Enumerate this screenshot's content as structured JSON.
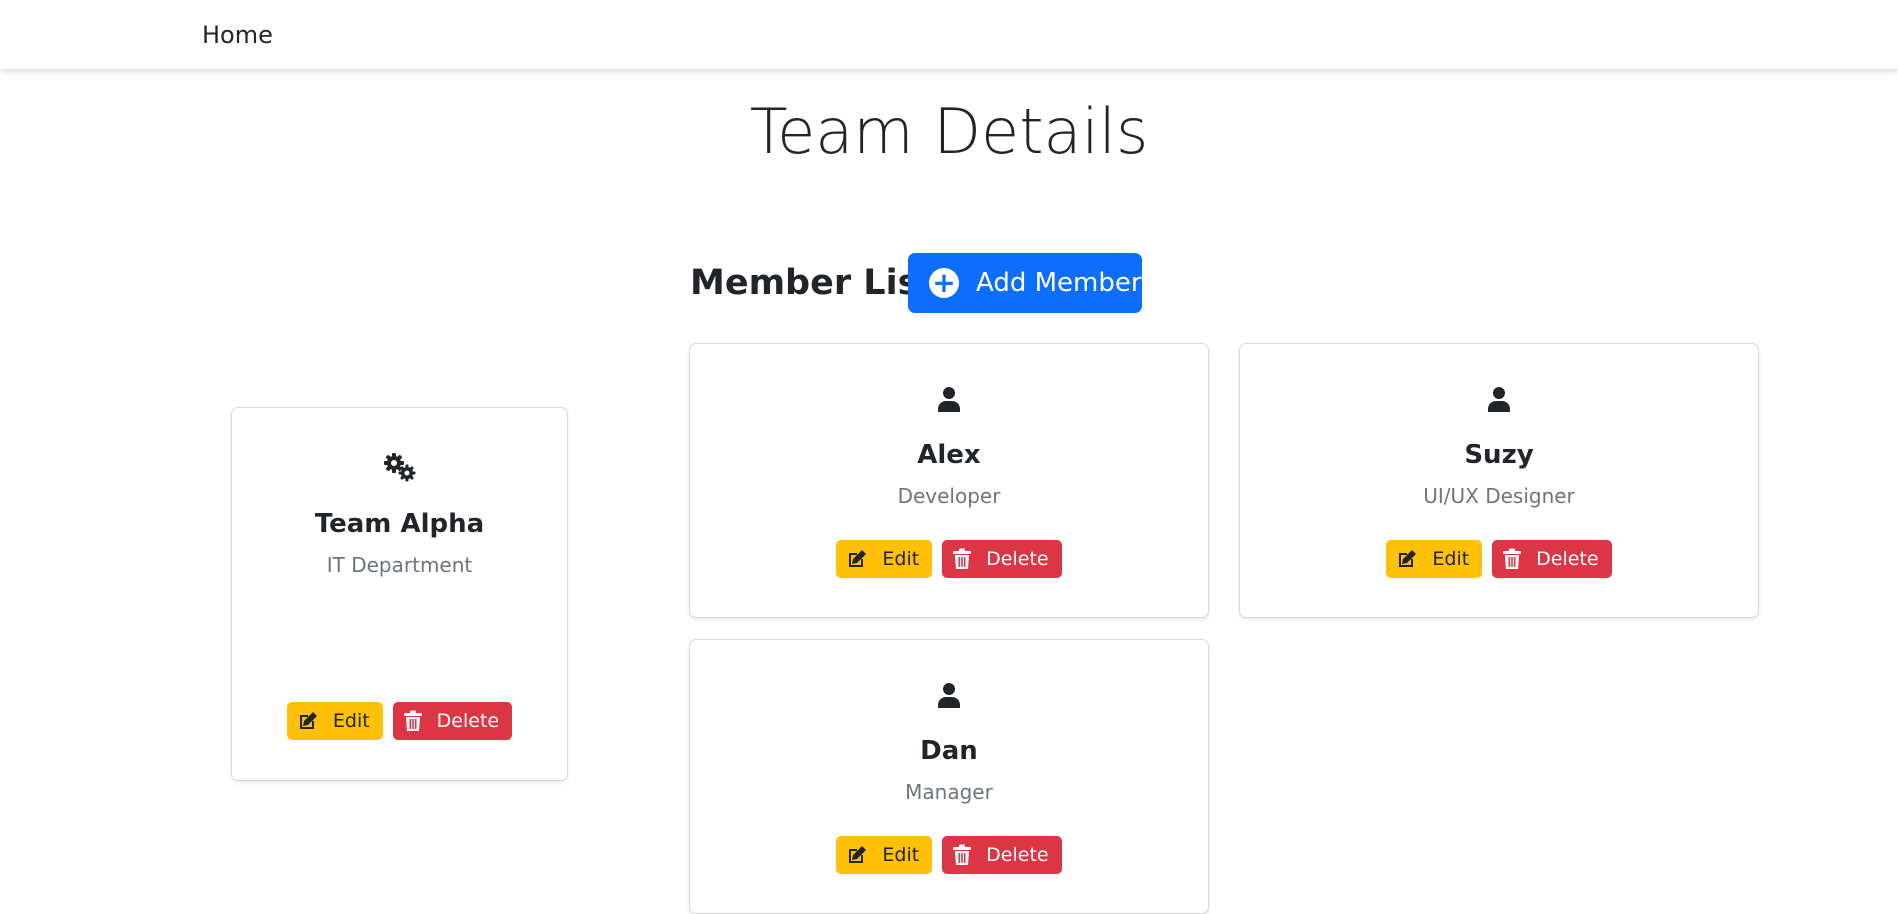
{
  "nav": {
    "home_label": "Home"
  },
  "page": {
    "title": "Team Details"
  },
  "members_section": {
    "title": "Member List",
    "add_label": "Add Member",
    "add_icon": "plus-circle-icon"
  },
  "team": {
    "name": "Team Alpha",
    "department": "IT Department",
    "icon": "gears-icon",
    "edit_label": "Edit",
    "delete_label": "Delete"
  },
  "members": [
    {
      "name": "Alex",
      "role": "Developer",
      "icon": "user-icon",
      "edit_label": "Edit",
      "delete_label": "Delete"
    },
    {
      "name": "Suzy",
      "role": "UI/UX Designer",
      "icon": "user-icon",
      "edit_label": "Edit",
      "delete_label": "Delete"
    },
    {
      "name": "Dan",
      "role": "Manager",
      "icon": "user-icon",
      "edit_label": "Edit",
      "delete_label": "Delete"
    }
  ],
  "colors": {
    "primary": "#0d6efd",
    "warning": "#ffc107",
    "danger": "#dc3545",
    "muted": "#6c757d"
  }
}
